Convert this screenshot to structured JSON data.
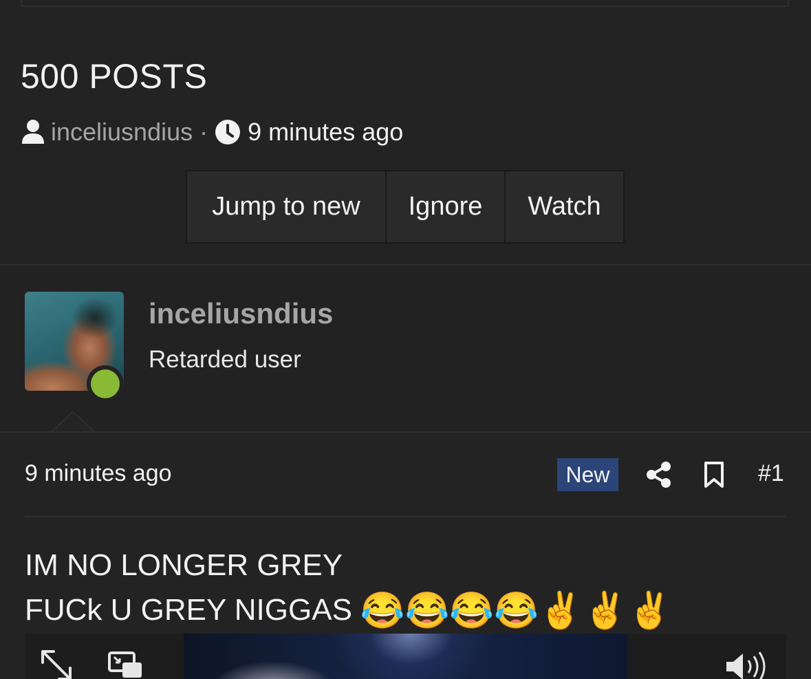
{
  "thread": {
    "title": "500 POSTS",
    "author": "inceliusndius",
    "separator": "·",
    "time": "9 minutes ago",
    "buttons": {
      "jump": "Jump to new",
      "ignore": "Ignore",
      "watch": "Watch"
    }
  },
  "post": {
    "user": {
      "name": "inceliusndius",
      "title": "Retarded user",
      "online": true,
      "status_color": "#8ab935"
    },
    "time": "9 minutes ago",
    "badge": "New",
    "badge_color": "#2b4579",
    "number": "#1",
    "icons": [
      "share-icon",
      "bookmark-icon"
    ],
    "body": {
      "line1": "IM NO LONGER GREY",
      "line2": "FUCk U GREY NIGGAS",
      "emojis": "😂😂😂😂✌️✌️✌️"
    },
    "video_controls": [
      "expand-icon",
      "picture-in-picture-icon",
      "volume-icon"
    ]
  }
}
